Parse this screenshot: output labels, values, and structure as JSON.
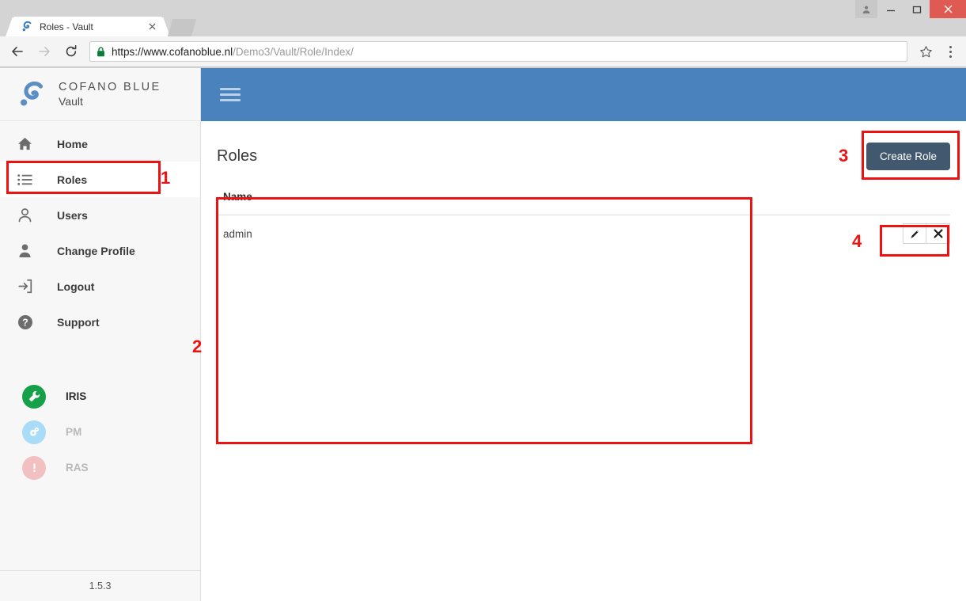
{
  "window": {
    "user_icon": "user-account-icon",
    "minimize_label": "Minimize",
    "maximize_label": "Maximize",
    "close_label": "Close"
  },
  "browser": {
    "tab": {
      "title": "Roles - Vault",
      "favicon": "cofano-favicon",
      "close_label": "Close tab"
    },
    "new_tab_label": "New tab",
    "back_label": "Back",
    "forward_label": "Forward",
    "reload_label": "Reload",
    "security": {
      "icon": "lock-icon",
      "state": "secure"
    },
    "url": {
      "scheme_host": "https://www.cofanoblue.nl",
      "path": "/Demo3/Vault/Role/Index/",
      "full": "https://www.cofanoblue.nl/Demo3/Vault/Role/Index/"
    },
    "bookmark_label": "Bookmark this page",
    "menu_label": "Customize and control Google Chrome"
  },
  "sidebar": {
    "brand": {
      "name": "COFANO BLUE",
      "sub": "Vault",
      "logo": "cofano-logo"
    },
    "items": [
      {
        "label": "Home",
        "icon": "home-icon",
        "active": false
      },
      {
        "label": "Roles",
        "icon": "list-icon",
        "active": true
      },
      {
        "label": "Users",
        "icon": "user-icon",
        "active": false
      },
      {
        "label": "Change Profile",
        "icon": "profile-icon",
        "active": false
      },
      {
        "label": "Logout",
        "icon": "logout-icon",
        "active": false
      },
      {
        "label": "Support",
        "icon": "help-icon",
        "active": false
      }
    ],
    "apps": [
      {
        "label": "IRIS",
        "icon": "wrench-icon",
        "color": "#16a04a",
        "dim": false
      },
      {
        "label": "PM",
        "icon": "gears-icon",
        "color": "#a9dcf7",
        "dim": true
      },
      {
        "label": "RAS",
        "icon": "exclamation-icon",
        "color": "#f2c0c0",
        "dim": true
      }
    ],
    "version": "1.5.3"
  },
  "topbar": {
    "menu_toggle_label": "Toggle navigation"
  },
  "page": {
    "title": "Roles",
    "create_button": "Create Role"
  },
  "table": {
    "columns": [
      "Name"
    ],
    "rows": [
      {
        "name": "admin",
        "actions": [
          {
            "icon": "pencil-icon",
            "label": "Edit"
          },
          {
            "icon": "close-icon",
            "label": "Delete"
          }
        ]
      }
    ]
  },
  "annotations": {
    "color": "#ee1111",
    "items": [
      {
        "number": "1",
        "target": "sidebar-item-roles"
      },
      {
        "number": "2",
        "target": "roles-table"
      },
      {
        "number": "3",
        "target": "create-role-button"
      },
      {
        "number": "4",
        "target": "row-action-buttons"
      }
    ]
  }
}
